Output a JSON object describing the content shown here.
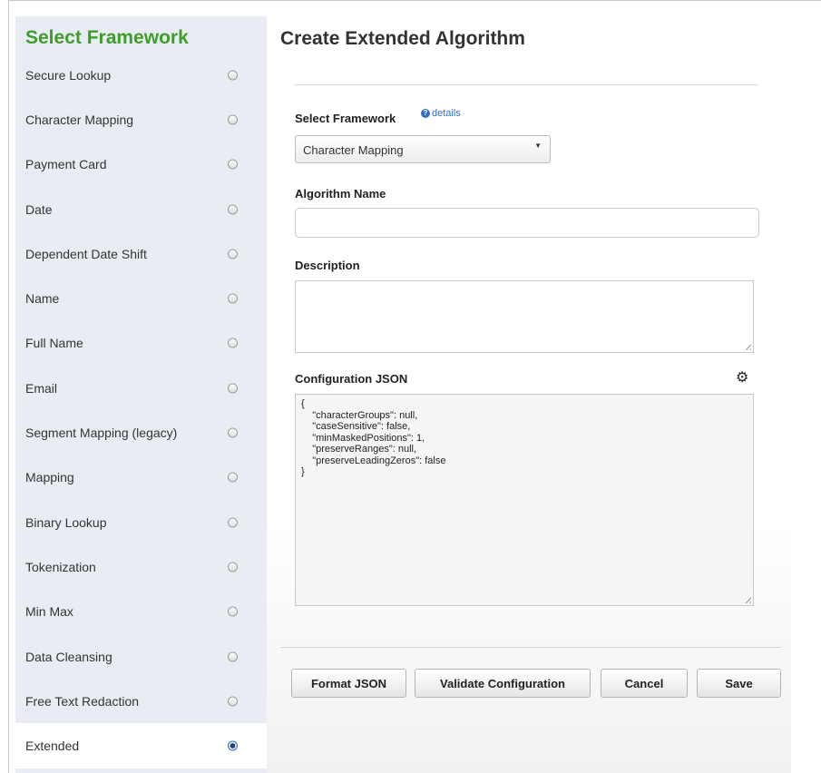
{
  "sidebar": {
    "title": "Select Framework",
    "items": [
      {
        "label": "Secure Lookup",
        "selected": false
      },
      {
        "label": "Character Mapping",
        "selected": false
      },
      {
        "label": "Payment Card",
        "selected": false
      },
      {
        "label": "Date",
        "selected": false
      },
      {
        "label": "Dependent Date Shift",
        "selected": false
      },
      {
        "label": "Name",
        "selected": false
      },
      {
        "label": "Full Name",
        "selected": false
      },
      {
        "label": "Email",
        "selected": false
      },
      {
        "label": "Segment Mapping (legacy)",
        "selected": false
      },
      {
        "label": "Mapping",
        "selected": false
      },
      {
        "label": "Binary Lookup",
        "selected": false
      },
      {
        "label": "Tokenization",
        "selected": false
      },
      {
        "label": "Min Max",
        "selected": false
      },
      {
        "label": "Data Cleansing",
        "selected": false
      },
      {
        "label": "Free Text Redaction",
        "selected": false
      },
      {
        "label": "Extended",
        "selected": true
      }
    ]
  },
  "main": {
    "title": "Create Extended Algorithm",
    "framework_label": "Select Framework",
    "details_link": "details",
    "framework_value": "Character Mapping",
    "name_label": "Algorithm Name",
    "name_value": "",
    "description_label": "Description",
    "description_value": "",
    "config_label": "Configuration JSON",
    "config_json": "{\n    \"characterGroups\": null,\n    \"caseSensitive\": false,\n    \"minMaskedPositions\": 1,\n    \"preserveRanges\": null,\n    \"preserveLeadingZeros\": false\n}"
  },
  "buttons": {
    "format": "Format JSON",
    "validate": "Validate Configuration",
    "cancel": "Cancel",
    "save": "Save"
  },
  "icons": {
    "help": "help-icon",
    "settings": "gear-icon",
    "radio": "radio-button"
  },
  "colors": {
    "sidebar_title": "#3f9d2b",
    "sidebar_bg": "#e9edf3",
    "link": "#2f6fc0"
  }
}
